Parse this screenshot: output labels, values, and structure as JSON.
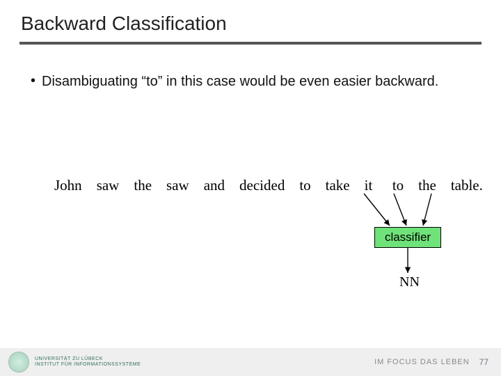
{
  "title": "Backward Classification",
  "bullet": "Disambiguating “to” in this case would be even easier backward.",
  "sentence": {
    "w0": "John",
    "w1": "saw",
    "w2": "the",
    "w3": "saw",
    "w4": "and",
    "w5": "decided",
    "w6": "to",
    "w7": "take",
    "w8": "it",
    "w9": "to",
    "w10": "the",
    "w11": "table."
  },
  "classifier_label": "classifier",
  "output_tag": "NN",
  "footer": {
    "uni_line1": "UNIVERSITÄT ZU LÜBECK",
    "uni_line2": "INSTITUT FÜR INFORMATIONSSYSTEME",
    "motto": "IM FOCUS DAS LEBEN",
    "page": "77"
  }
}
